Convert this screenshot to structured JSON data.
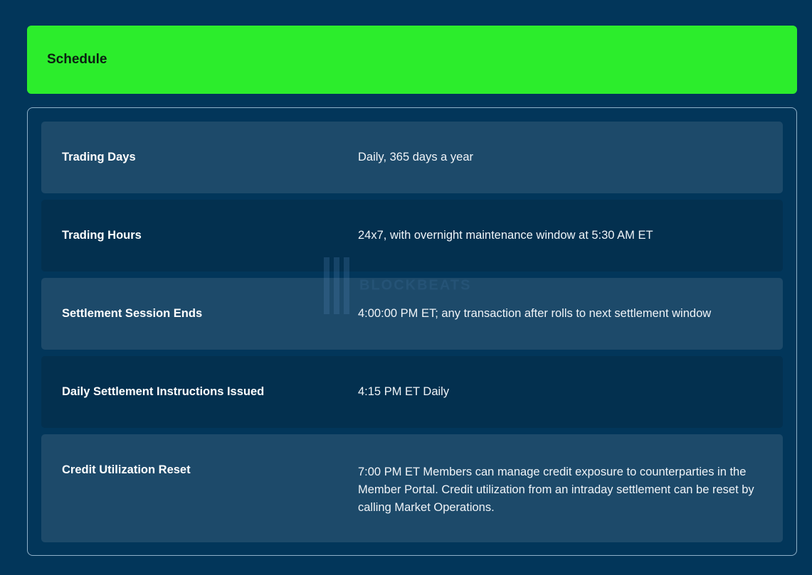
{
  "header": {
    "title": "Schedule"
  },
  "rows": [
    {
      "label": "Trading Days",
      "value": "Daily, 365 days a year"
    },
    {
      "label": "Trading Hours",
      "value": "24x7, with overnight maintenance window at 5:30 AM ET"
    },
    {
      "label": "Settlement Session Ends",
      "value": "4:00:00 PM ET; any transaction after rolls to next settlement window"
    },
    {
      "label": "Daily Settlement Instructions Issued",
      "value": "4:15 PM ET Daily"
    },
    {
      "label": "Credit Utilization Reset",
      "value": "7:00 PM ET Members can manage credit exposure to counterparties in the Member Portal. Credit utilization from an intraday settlement can be reset by calling Market Operations."
    }
  ],
  "watermark": "BLOCKBEATS"
}
